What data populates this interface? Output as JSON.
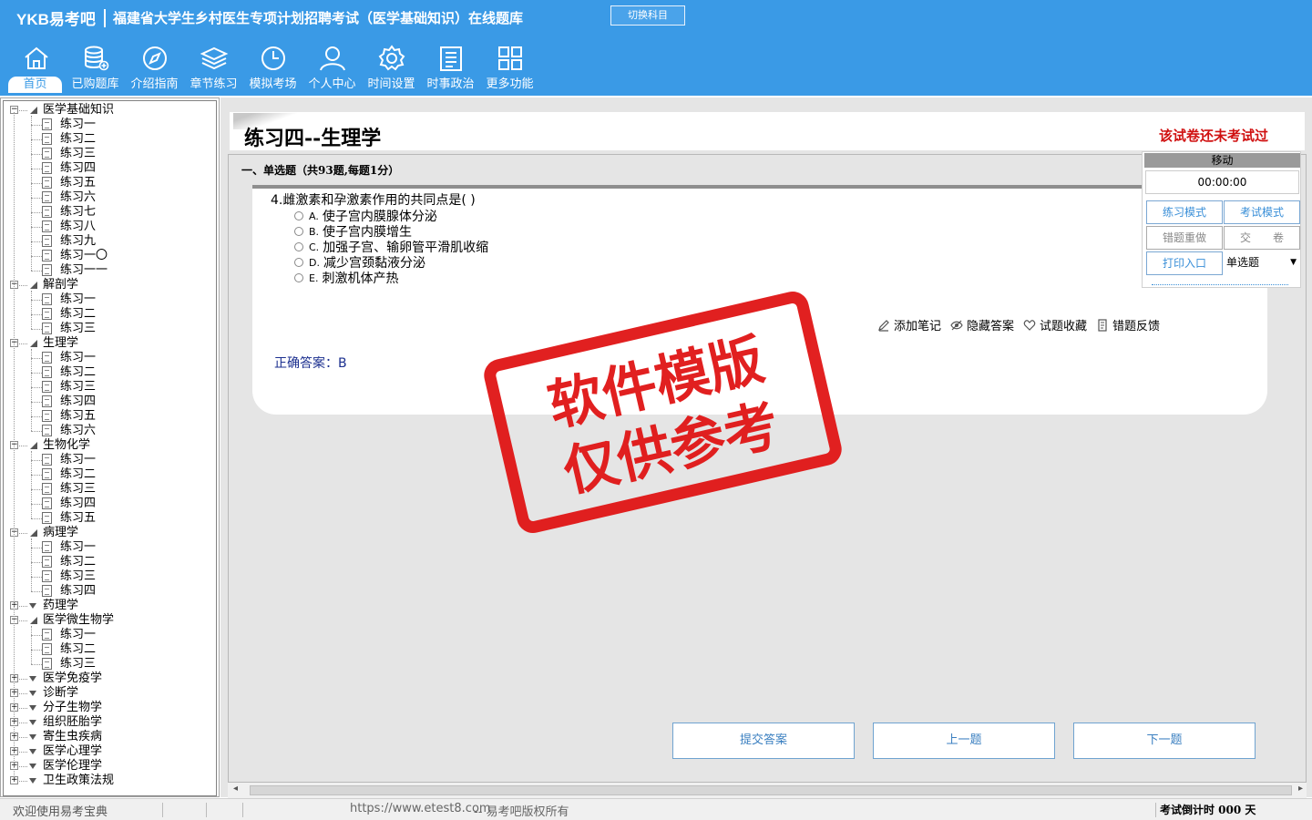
{
  "header": {
    "logo": "YKB易考吧",
    "title": "福建省大学生乡村医生专项计划招聘考试（医学基础知识）在线题库",
    "switch_label": "切换科目"
  },
  "nav": [
    {
      "label": "首页",
      "icon": "home-icon",
      "active": true
    },
    {
      "label": "已购题库",
      "icon": "database-icon"
    },
    {
      "label": "介绍指南",
      "icon": "compass-icon"
    },
    {
      "label": "章节练习",
      "icon": "layers-icon"
    },
    {
      "label": "模拟考场",
      "icon": "clock-icon"
    },
    {
      "label": "个人中心",
      "icon": "user-icon"
    },
    {
      "label": "时间设置",
      "icon": "gear-icon"
    },
    {
      "label": "时事政治",
      "icon": "news-icon"
    },
    {
      "label": "更多功能",
      "icon": "grid-icon"
    }
  ],
  "tree": [
    {
      "label": "医学基础知识",
      "expanded": true,
      "children": [
        "练习一",
        "练习二",
        "练习三",
        "练习四",
        "练习五",
        "练习六",
        "练习七",
        "练习八",
        "练习九",
        "练习一〇",
        "练习一一"
      ]
    },
    {
      "label": "解剖学",
      "expanded": true,
      "children": [
        "练习一",
        "练习二",
        "练习三"
      ]
    },
    {
      "label": "生理学",
      "expanded": true,
      "children": [
        "练习一",
        "练习二",
        "练习三",
        "练习四",
        "练习五",
        "练习六"
      ]
    },
    {
      "label": "生物化学",
      "expanded": true,
      "children": [
        "练习一",
        "练习二",
        "练习三",
        "练习四",
        "练习五"
      ]
    },
    {
      "label": "病理学",
      "expanded": true,
      "children": [
        "练习一",
        "练习二",
        "练习三",
        "练习四"
      ]
    },
    {
      "label": "药理学",
      "expanded": false,
      "children": []
    },
    {
      "label": "医学微生物学",
      "expanded": true,
      "children": [
        "练习一",
        "练习二",
        "练习三"
      ]
    },
    {
      "label": "医学免疫学",
      "expanded": false,
      "children": []
    },
    {
      "label": "诊断学",
      "expanded": false,
      "children": []
    },
    {
      "label": "分子生物学",
      "expanded": false,
      "children": []
    },
    {
      "label": "组织胚胎学",
      "expanded": false,
      "children": []
    },
    {
      "label": "寄生虫疾病",
      "expanded": false,
      "children": []
    },
    {
      "label": "医学心理学",
      "expanded": false,
      "children": []
    },
    {
      "label": "医学伦理学",
      "expanded": false,
      "children": []
    },
    {
      "label": "卫生政策法规",
      "expanded": false,
      "children": []
    }
  ],
  "main": {
    "page_title": "练习四--生理学",
    "status": "该试卷还未考试过",
    "section": "一、单选题（共93题,每题1分）",
    "question": "4.雌激素和孕激素作用的共同点是( )",
    "options": [
      {
        "letter": "A.",
        "text": "使子宫内膜腺体分泌"
      },
      {
        "letter": "B.",
        "text": "使子宫内膜增生"
      },
      {
        "letter": "C.",
        "text": "加强子宫、输卵管平滑肌收缩"
      },
      {
        "letter": "D.",
        "text": "减少宫颈黏液分泌"
      },
      {
        "letter": "E.",
        "text": "刺激机体产热"
      }
    ],
    "actions": [
      {
        "label": "添加笔记",
        "icon": "pencil-icon"
      },
      {
        "label": "隐藏答案",
        "icon": "eye-icon"
      },
      {
        "label": "试题收藏",
        "icon": "heart-icon"
      },
      {
        "label": "错题反馈",
        "icon": "feedback-icon"
      }
    ],
    "answer": "正确答案：B",
    "submit_label": "提交答案",
    "prev_label": "上一题",
    "next_label": "下一题"
  },
  "float_panel": {
    "header": "移动",
    "timer": "00:00:00",
    "practice_mode": "练习模式",
    "exam_mode": "考试模式",
    "redo_wrong": "错题重做",
    "hand_in": "交　　卷",
    "print": "打印入口",
    "question_type": "单选题"
  },
  "watermark": {
    "line1": "软件模版",
    "line2": "仅供参考"
  },
  "statusbar": {
    "welcome": "欢迎使用易考宝典",
    "url": "https://www.etest8.com",
    "copyright": "-- 易考吧版权所有",
    "countdown": "考试倒计时 000 天"
  }
}
